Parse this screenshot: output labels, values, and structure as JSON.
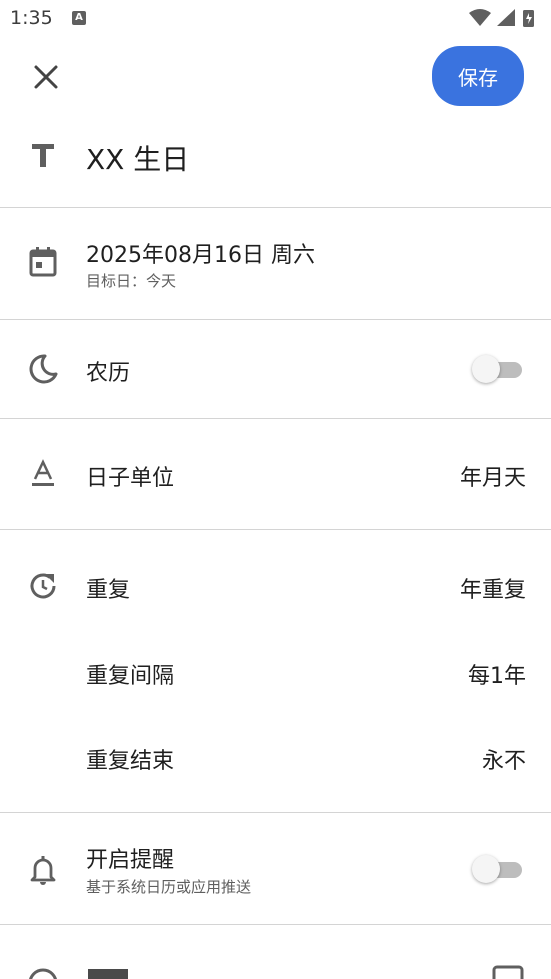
{
  "status_bar": {
    "time": "1:35",
    "notification_badge": "A"
  },
  "toolbar": {
    "save_label": "保存"
  },
  "event": {
    "title": "XX 生日"
  },
  "date": {
    "value": "2025年08月16日 周六",
    "target_label": "目标日：今天"
  },
  "lunar": {
    "label": "农历",
    "enabled": false
  },
  "day_unit": {
    "label": "日子单位",
    "value": "年月天"
  },
  "repeat": {
    "label": "重复",
    "value": "年重复",
    "interval_label": "重复间隔",
    "interval_value": "每1年",
    "end_label": "重复结束",
    "end_value": "永不"
  },
  "reminder": {
    "label": "开启提醒",
    "sub": "基于系统日历或应用推送",
    "enabled": false
  },
  "colors": {
    "accent": "#3a73df",
    "icon": "#5f5f5f",
    "divider": "#d4d4d4"
  }
}
